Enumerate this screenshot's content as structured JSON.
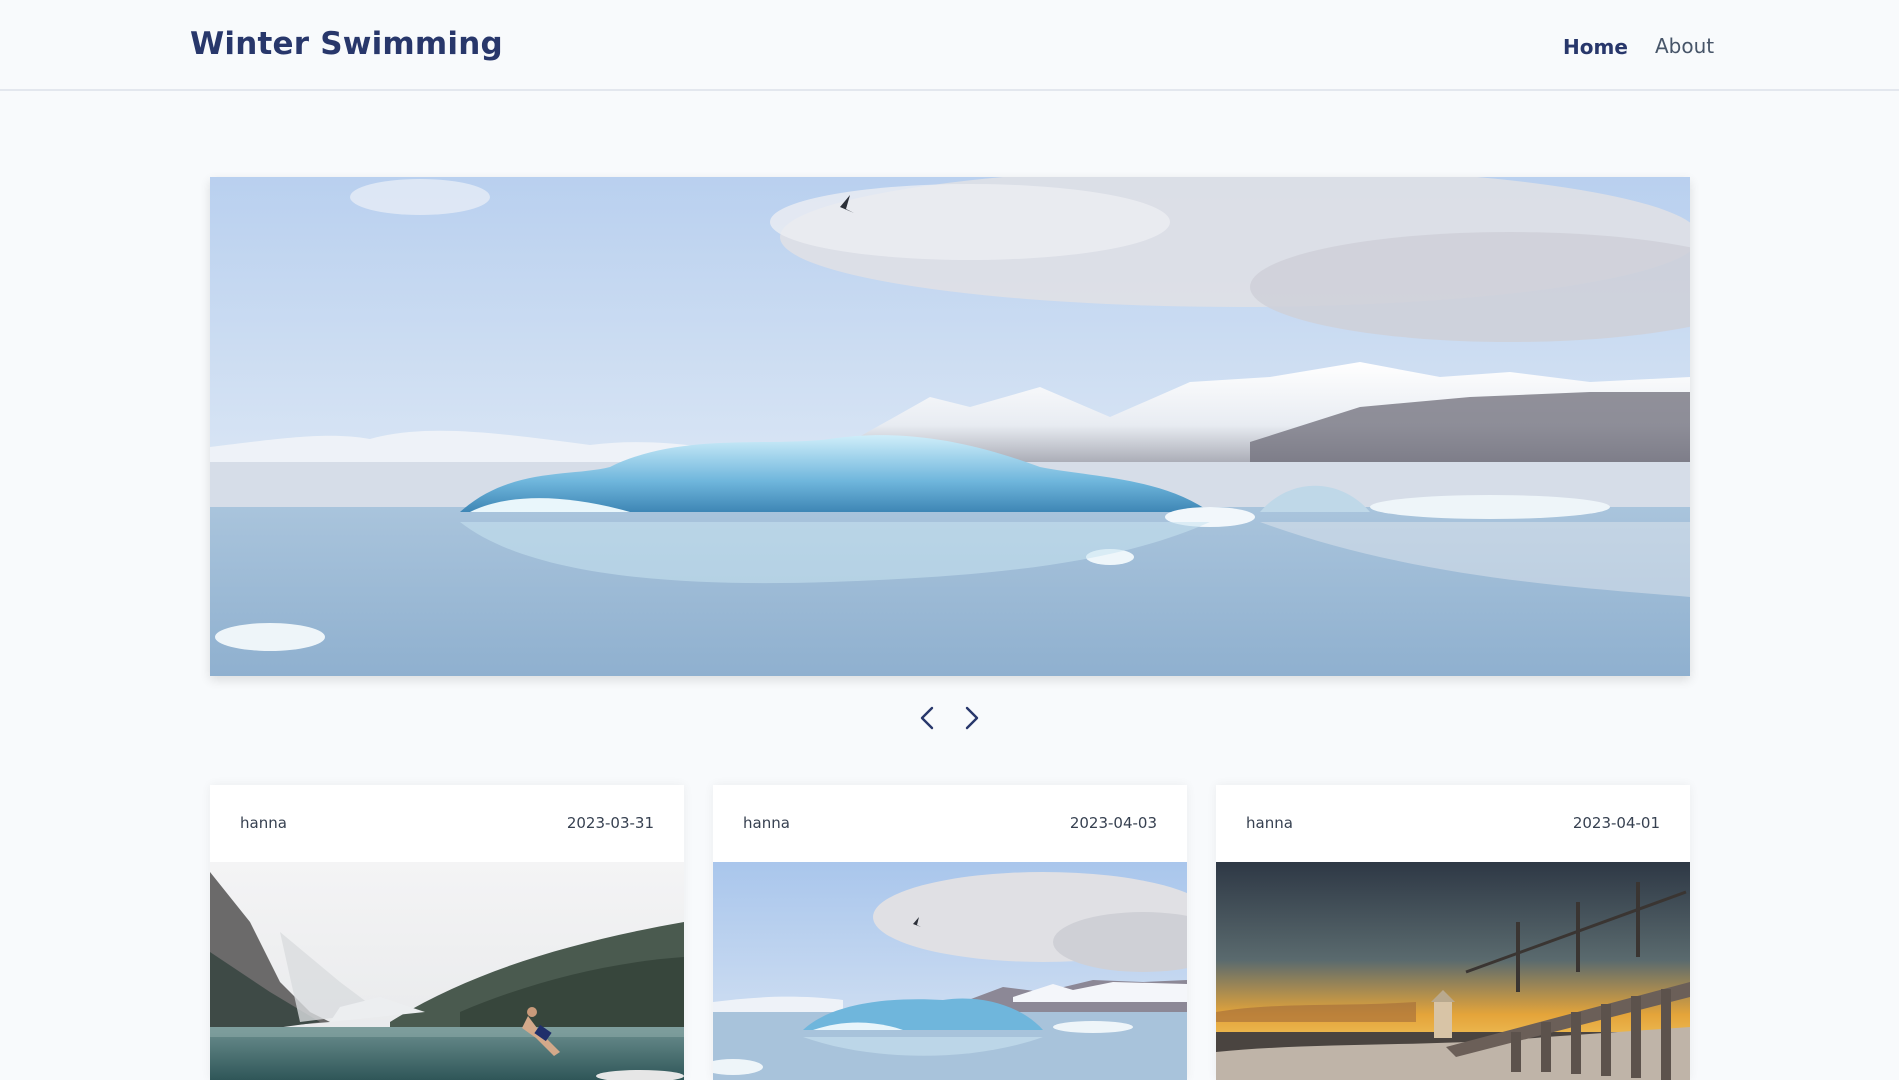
{
  "header": {
    "brand": "Winter Swimming",
    "nav": {
      "home": "Home",
      "about": "About"
    }
  },
  "carousel": {
    "slide_image": "glacier-lagoon-icebergs-photo",
    "prev_icon": "chevron-left-icon",
    "next_icon": "chevron-right-icon"
  },
  "cards": [
    {
      "author": "hanna",
      "date": "2023-03-31",
      "image": "mountain-lake-swimmer-photo"
    },
    {
      "author": "hanna",
      "date": "2023-04-03",
      "image": "glacier-lagoon-photo"
    },
    {
      "author": "hanna",
      "date": "2023-04-01",
      "image": "frozen-pier-sunset-photo"
    }
  ],
  "colors": {
    "brand": "#28376b",
    "background": "#f8fafc",
    "text_muted": "#475569"
  }
}
